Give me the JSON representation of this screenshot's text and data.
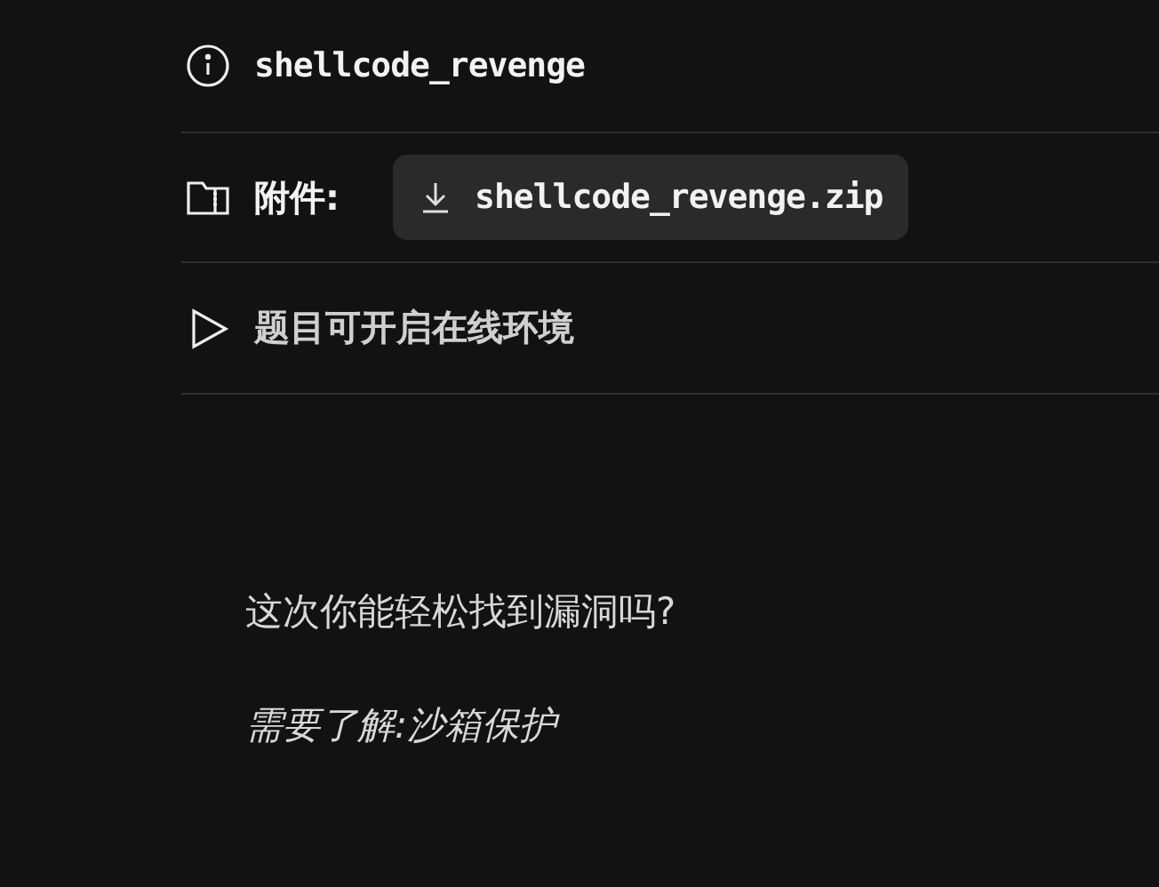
{
  "challenge": {
    "name": "shellcode_revenge"
  },
  "attachment": {
    "label": "附件:",
    "file": "shellcode_revenge.zip"
  },
  "environment": {
    "label": "题目可开启在线环境"
  },
  "description": {
    "paragraphs": [
      {
        "text": "这次你能轻松找到漏洞吗?",
        "italic": false
      },
      {
        "text": "需要了解:沙箱保护",
        "italic": true
      }
    ]
  }
}
